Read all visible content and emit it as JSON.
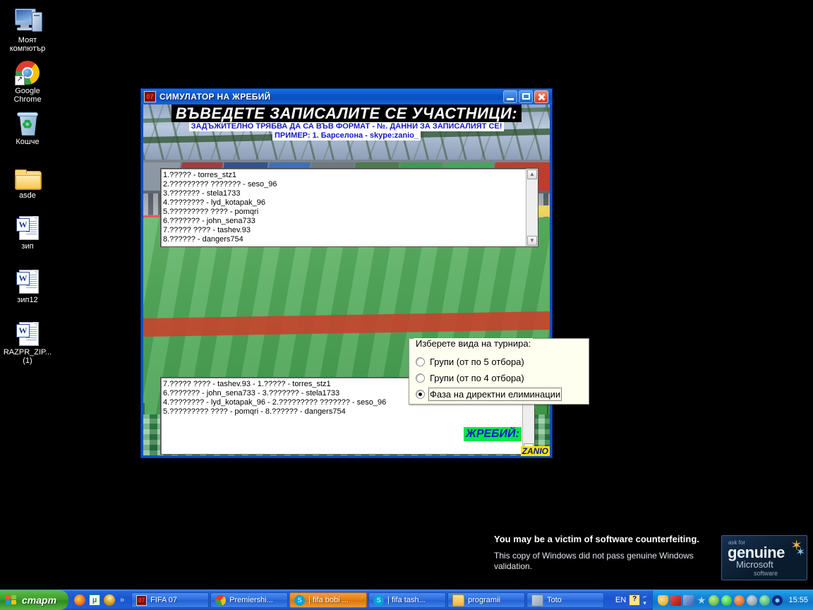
{
  "desktop": {
    "icons": [
      {
        "name": "my-computer",
        "label": "Моят компютър",
        "type": "computer"
      },
      {
        "name": "google-chrome",
        "label": "Google Chrome",
        "type": "chrome"
      },
      {
        "name": "recycle-bin",
        "label": "Кошче",
        "type": "bin"
      },
      {
        "name": "folder-asde",
        "label": "asde",
        "type": "folder"
      },
      {
        "name": "doc-zip",
        "label": "зип",
        "type": "word"
      },
      {
        "name": "doc-zip12",
        "label": "зип12",
        "type": "word"
      },
      {
        "name": "doc-razpr-zip",
        "label": "RAZPR_ZIP... (1)",
        "type": "word"
      }
    ]
  },
  "genuine_notice": {
    "title": "You may be a victim of software counterfeiting.",
    "body": "This copy of Windows did not pass genuine Windows validation.",
    "badge": {
      "line1": "ask for",
      "line2": "genuine",
      "line3": "Microsoft",
      "line4": "software"
    }
  },
  "window": {
    "title": "СИМУЛАТОР НА ЖРЕБИЙ",
    "icon_label": "07",
    "buttons": {
      "minimize": "Minimize",
      "maximize": "Maximize",
      "close": "Close"
    },
    "header": {
      "line1": "ВЪВЕДЕТЕ ЗАПИСАЛИТЕ СЕ УЧАСТНИЦИ:",
      "line2": "ЗАДЪЖИТЕЛНО ТРЯБВА ДА СА ВЪВ ФОРМАТ - №. ДАННИ ЗА ЗАПИСАЛИЯТ СЕ!",
      "line3": "ПРИМЕР: 1. Барселона - skype:zanio_"
    },
    "participants_input": {
      "value": "1.????? - torres_stz1\n2.????????? ??????? - seso_96\n3.??????? - stela1733\n4.???????? - lyd_kotapak_96\n5.????????? ???? - pomqri\n6.??????? - john_sena733\n7.????? ???? - tashev.93\n8.?????? - dangers754",
      "placeholder": ""
    },
    "tournament_group": {
      "legend": "Изберете вида на турнира:",
      "options": [
        {
          "label": "Групи (от по 5 отбора)",
          "selected": false
        },
        {
          "label": "Групи (от по 4 отбора)",
          "selected": false
        },
        {
          "label": "Фаза на директни елиминации",
          "selected": true
        }
      ]
    },
    "draw_label": "ЖРЕБИЙ:",
    "draw_output": {
      "value": "7.????? ???? - tashev.93 - 1.????? - torres_stz1\n6.??????? - john_sena733 - 3.??????? - stela1733\n4.???????? - lyd_kotapak_96 - 2.????????? ??????? - seso_96\n5.????????? ???? - pomqri - 8.?????? - dangers754",
      "placeholder": ""
    },
    "watermark": "ZANIO",
    "scroll": {
      "up": "▲",
      "down": "▼"
    }
  },
  "taskbar": {
    "start_label": "старт",
    "quick_launch": [
      {
        "name": "firefox-icon",
        "title": "Mozilla Firefox"
      },
      {
        "name": "utorrent-icon",
        "title": "µTorrent"
      },
      {
        "name": "comet-icon",
        "title": "Internet"
      }
    ],
    "overflow": "»",
    "tasks": [
      {
        "label": "FIFA 07",
        "icon": "fifa-icon",
        "active": false
      },
      {
        "label": "Premiershi...",
        "icon": "chrome-icon",
        "active": false
      },
      {
        "label": "| fifa bobi ...",
        "icon": "skype-icon",
        "active": true
      },
      {
        "label": "| fifa tash...",
        "icon": "skype-icon",
        "active": false
      },
      {
        "label": "programii",
        "icon": "folder-icon",
        "active": false
      },
      {
        "label": "Toto",
        "icon": "app-icon",
        "active": false
      }
    ],
    "language": "EN",
    "language_help": "?",
    "tray_icons": [
      {
        "name": "security-shield-icon",
        "color": "#e8b82c"
      },
      {
        "name": "adobe-reader-icon",
        "color": "#cf2222"
      },
      {
        "name": "network-icon",
        "color": "#5b7fd4"
      },
      {
        "name": "star-icon",
        "color": "#9fd0f0"
      },
      {
        "name": "antivirus-check-icon",
        "color": "#7ac943"
      },
      {
        "name": "power-icon",
        "color": "#3fd64f"
      },
      {
        "name": "update-icon",
        "color": "#f05a28"
      },
      {
        "name": "volume-icon",
        "color": "#9aa6b2"
      },
      {
        "name": "bluetooth-icon",
        "color": "#4dbd7a"
      },
      {
        "name": "wireless-icon",
        "color": "#1b3fa0"
      }
    ],
    "clock": "15:55"
  }
}
